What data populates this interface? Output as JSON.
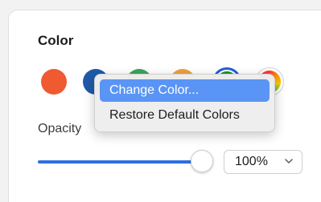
{
  "color_section": {
    "title": "Color",
    "swatches": [
      {
        "name": "red",
        "color": "#f05a30"
      },
      {
        "name": "blue",
        "color": "#1f5aa8"
      },
      {
        "name": "green",
        "color": "#3aa55a"
      },
      {
        "name": "orange",
        "color": "#f0a040"
      },
      {
        "name": "dark-green",
        "color": "#1f8f2f",
        "selected": true
      },
      {
        "name": "multicolor"
      }
    ]
  },
  "context_menu": {
    "items": [
      {
        "label": "Change Color...",
        "highlighted": true
      },
      {
        "label": "Restore Default Colors",
        "highlighted": false
      }
    ],
    "highlight_color": "#5a95f5"
  },
  "opacity": {
    "label": "Opacity",
    "value_fraction": 1.0,
    "select_value": "100%",
    "slider_color": "#2f6fe0"
  }
}
